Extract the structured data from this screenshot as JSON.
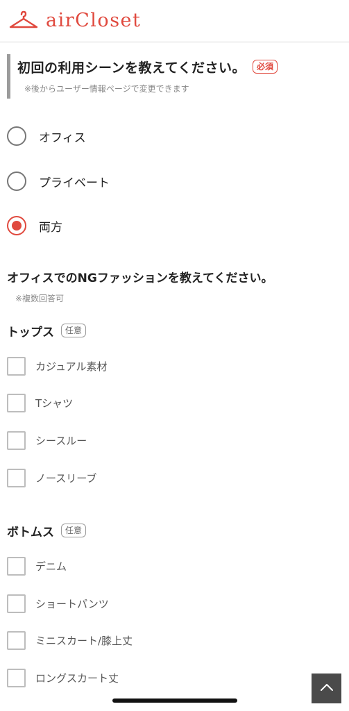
{
  "header": {
    "logo_text": "airCloset",
    "brand_color": "#e0493e"
  },
  "question1": {
    "title": "初回の利用シーンを教えてください。",
    "required_badge": "必須",
    "note": "※後からユーザー情報ページで変更できます",
    "options": [
      {
        "label": "オフィス",
        "selected": false
      },
      {
        "label": "プライベート",
        "selected": false
      },
      {
        "label": "両方",
        "selected": true
      }
    ]
  },
  "question2": {
    "title": "オフィスでのNGファッションを教えてください。",
    "note": "※複数回答可",
    "sections": [
      {
        "title": "トップス",
        "badge": "任意",
        "items": [
          {
            "label": "カジュアル素材",
            "checked": false
          },
          {
            "label": "Tシャツ",
            "checked": false
          },
          {
            "label": "シースルー",
            "checked": false
          },
          {
            "label": "ノースリーブ",
            "checked": false
          }
        ]
      },
      {
        "title": "ボトムス",
        "badge": "任意",
        "items": [
          {
            "label": "デニム",
            "checked": false
          },
          {
            "label": "ショートパンツ",
            "checked": false
          },
          {
            "label": "ミニスカート/膝上丈",
            "checked": false
          },
          {
            "label": "ロングスカート丈",
            "checked": false
          }
        ]
      }
    ]
  },
  "icons": {
    "logo": "hanger-icon",
    "scroll_top": "chevron-up-icon"
  }
}
